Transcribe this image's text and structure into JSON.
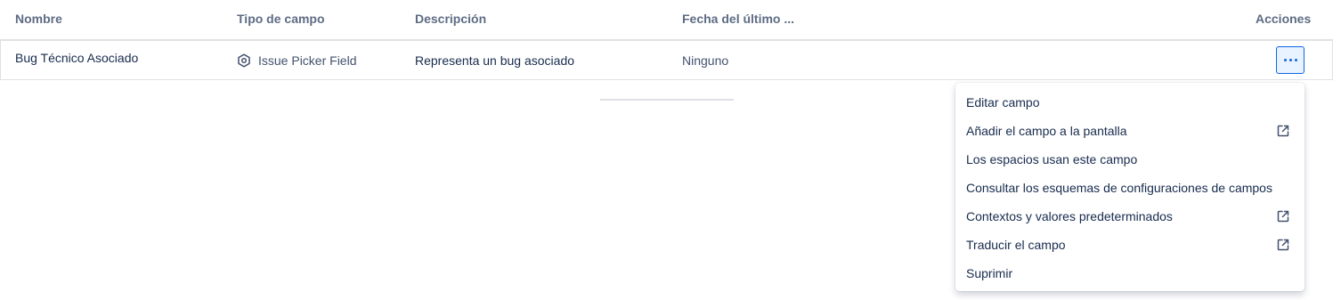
{
  "table": {
    "headers": {
      "name": "Nombre",
      "type": "Tipo de campo",
      "description": "Descripción",
      "last_date": "Fecha del último ...",
      "actions": "Acciones"
    },
    "rows": [
      {
        "name": "Bug Técnico Asociado",
        "type": "Issue Picker Field",
        "type_icon": "hexagon-gear-icon",
        "description": "Representa un bug asociado",
        "last_date": "Ninguno"
      }
    ]
  },
  "actions_menu": {
    "trigger_icon": "more-horizontal-icon",
    "accent_color": "#0c66e4",
    "items": [
      {
        "label": "Editar campo",
        "external": false
      },
      {
        "label": "Añadir el campo a la pantalla",
        "external": true
      },
      {
        "label": "Los espacios usan este campo",
        "external": false
      },
      {
        "label": "Consultar los esquemas de configuraciones de campos",
        "external": false
      },
      {
        "label": "Contextos y valores predeterminados",
        "external": true
      },
      {
        "label": "Traducir el campo",
        "external": true
      },
      {
        "label": "Suprimir",
        "external": false
      }
    ]
  }
}
